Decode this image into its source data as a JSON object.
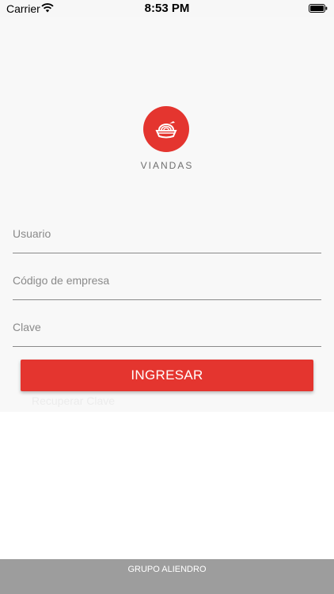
{
  "status_bar": {
    "carrier": "Carrier",
    "time": "8:53 PM"
  },
  "brand": {
    "name": "VIANDAS",
    "accent_color": "#e4352f"
  },
  "form": {
    "username_placeholder": "Usuario",
    "company_code_placeholder": "Código de empresa",
    "password_placeholder": "Clave",
    "submit_label": "INGRESAR",
    "recover_label": "Recuperar Clave"
  },
  "footer": {
    "text": "GRUPO ALIENDRO"
  },
  "icons": [
    "wifi-icon",
    "battery-icon",
    "food-bowl-logo-icon"
  ]
}
